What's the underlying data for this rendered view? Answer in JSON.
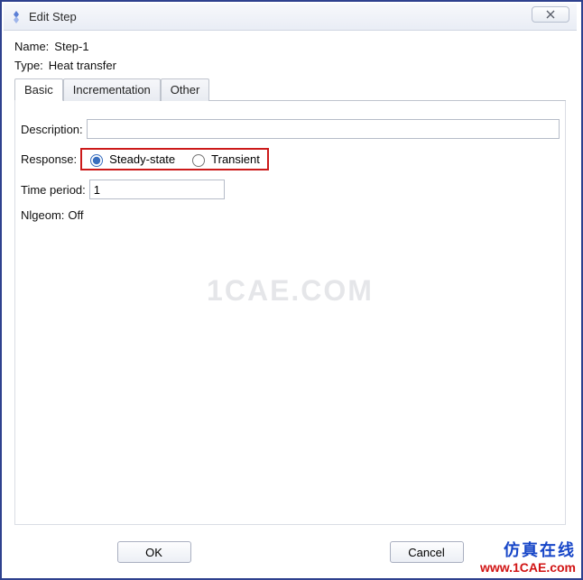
{
  "window": {
    "title": "Edit Step",
    "close_label": "✕"
  },
  "header": {
    "name_label": "Name:",
    "name_value": "Step-1",
    "type_label": "Type:",
    "type_value": "Heat transfer"
  },
  "tabs": {
    "basic": "Basic",
    "incrementation": "Incrementation",
    "other": "Other"
  },
  "basic": {
    "description_label": "Description:",
    "description_value": "",
    "response_label": "Response:",
    "steady_label": "Steady-state",
    "transient_label": "Transient",
    "response_selected": "steady",
    "time_period_label": "Time period:",
    "time_period_value": "1",
    "nlgeom_label": "Nlgeom:",
    "nlgeom_value": "Off"
  },
  "watermark": "1CAE.COM",
  "buttons": {
    "ok": "OK",
    "cancel": "Cancel"
  },
  "footer": {
    "brand_cn": "仿真在线",
    "brand_url": "www.1CAE.com"
  }
}
